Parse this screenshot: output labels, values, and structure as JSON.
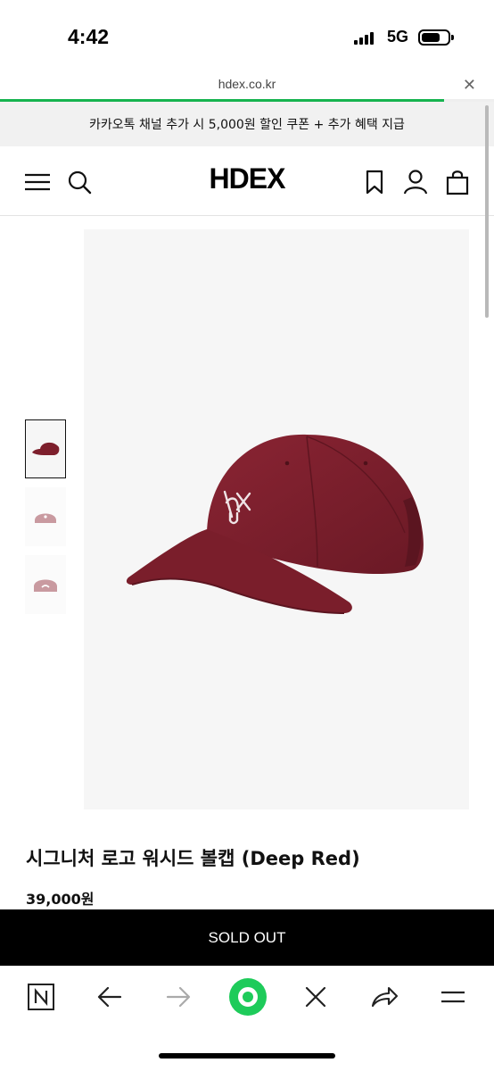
{
  "status_bar": {
    "time": "4:42",
    "network": "5G"
  },
  "url_bar": {
    "url": "hdex.co.kr",
    "close_icon": "close-icon"
  },
  "promo": {
    "text": "카카오톡 채널 추가 시 5,000원 할인 쿠폰 + 추가 혜택 지급"
  },
  "header": {
    "logo": "HDEX",
    "icons": [
      "hamburger-menu-icon",
      "search-icon",
      "bookmark-icon",
      "user-icon",
      "shopping-bag-icon"
    ]
  },
  "product": {
    "title": "시그니처 로고 워시드 볼캡 (Deep Red)",
    "price": "39,000원",
    "button": "SOLD OUT",
    "colors": {
      "main": "#7d1f2c",
      "thumb_alt": "#c99aa0",
      "accent": "#16b34f"
    }
  },
  "browser_bar": {
    "icons": [
      "naver-n-icon",
      "back-arrow-icon",
      "forward-arrow-icon",
      "green-dot-icon",
      "close-icon",
      "share-icon",
      "menu-icon"
    ]
  }
}
